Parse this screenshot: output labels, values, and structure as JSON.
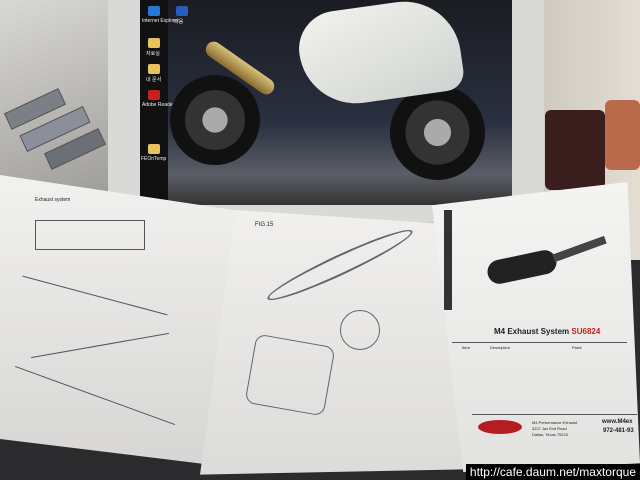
{
  "desktop": {
    "icons": [
      {
        "label": "Internet Explorer",
        "color": "#2a78d6"
      },
      {
        "label": "다음",
        "color": "#2a5bbf"
      },
      {
        "label": "자료실",
        "color": "#e8c25a"
      },
      {
        "label": "내 문서",
        "color": "#e8c25a"
      },
      {
        "label": "Adobe Reader",
        "color": "#c8201e"
      },
      {
        "label": "FEOnTemp",
        "color": "#e8c25a"
      }
    ]
  },
  "papers": {
    "left": {
      "header": "Exhaust system"
    },
    "middle": {
      "figure_label": "FIG.15"
    },
    "right": {
      "title": "M4 Exhaust System",
      "part_number": "SU6824",
      "columns": [
        "Item",
        "Description",
        "Part#"
      ],
      "company": "M4 Performance Exhaust",
      "address": "3227 Jax Exit Road",
      "city": "Dallas, Texas 75220",
      "website": "www.M4ex",
      "phone": "972-481-93"
    }
  },
  "watermark": "http://cafe.daum.net/maxtorque",
  "colors": {
    "accent_red": "#c8201e",
    "brand_red": "#b51d22"
  }
}
